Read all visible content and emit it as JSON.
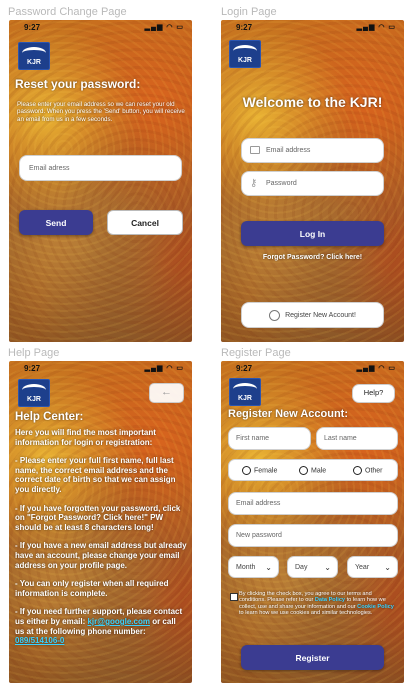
{
  "captions": {
    "password_change": "Password Change Page",
    "login": "Login Page",
    "help": "Help Page",
    "register": "Register Page"
  },
  "status": {
    "time": "9:27",
    "icons": "signal-wifi-battery"
  },
  "logo": {
    "text": "KJR"
  },
  "password_change": {
    "title": "Reset your password:",
    "description": "Please enter your email address so we can reset your old password. When you press the 'Send' button, you will receive an email from us in a few seconds.",
    "email_placeholder": "Email adress",
    "send_label": "Send",
    "cancel_label": "Cancel"
  },
  "login": {
    "title": "Welcome to the KJR!",
    "email_placeholder": "Email address",
    "password_placeholder": "Password",
    "login_label": "Log In",
    "forgot_label": "Forgot Password? Click here!",
    "register_label": "Register New Account!"
  },
  "help": {
    "title": "Help Center:",
    "p1": "Here you will find the most important information for login or registration:",
    "p2": "- Please enter your full first name, full last name, the correct email address and the correct date of birth so that we can assign you directly.",
    "p3": "- If you have forgotten your password, click on \"Forgot Password? Click here!\" PW should be at least 8 characters long!",
    "p4": "- If you have a new email address but already have an account, please change your email address on your profile page.",
    "p5": "- You can only register when all required information is complete.",
    "p6_a": "- If you need further support, please contact us either by email:",
    "p6_email": "kjr@google.com",
    "p6_b": "or call us at the following phone number:",
    "p6_phone": "089/514106-0"
  },
  "register": {
    "help_label": "Help?",
    "title": "Register New Account:",
    "first_name_placeholder": "First name",
    "last_name_placeholder": "Last name",
    "gender_options": [
      "Female",
      "Male",
      "Other"
    ],
    "email_placeholder": "Email address",
    "password_placeholder": "New password",
    "month_label": "Month",
    "day_label": "Day",
    "year_label": "Year",
    "consent_a": "By clicking the check box, you agree to our terms and conditions. Please refer to our",
    "consent_data_policy": "Data Policy",
    "consent_b": "to learn how we collect, use and share your information and our",
    "consent_cookie_policy": "Cookie Policy",
    "consent_c": "to learn how we use cookies and similar technologies.",
    "register_label": "Register"
  },
  "colors": {
    "primary_button": "#3b3c91",
    "link_cyan": "#39d2ff",
    "logo_blue": "#1d3f8c"
  }
}
